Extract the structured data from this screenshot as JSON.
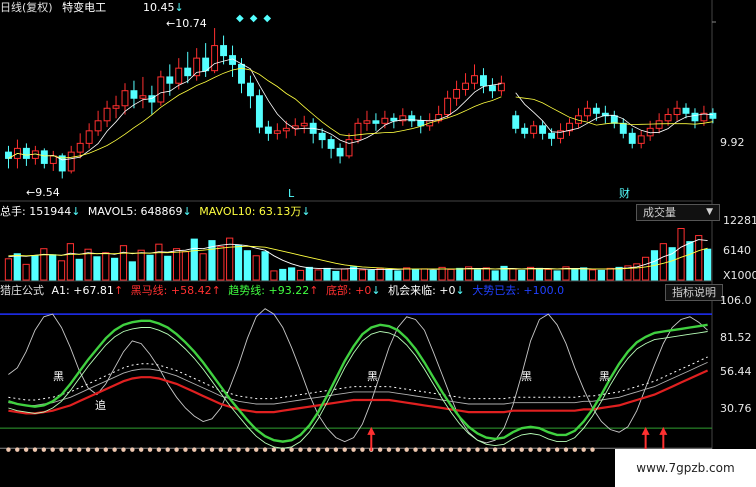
{
  "header": {
    "period_label": "日线(复权)",
    "stock_name": "特变电工"
  },
  "price_panel": {
    "peak_label": "10.45",
    "high_label": "10.74",
    "low_label": "9.54",
    "axis_label": "9.92",
    "marker_l": "L",
    "marker_cai": "财"
  },
  "volume_panel": {
    "legend": [
      {
        "text": "总手: 151944",
        "color": "#ffffff"
      },
      {
        "text": "MAVOL5: 648869",
        "color": "#ffffff"
      },
      {
        "text": "MAVOL10: 63.13万",
        "color": "#ffff40"
      }
    ],
    "selector_label": "成交量",
    "axis_labels": [
      "12281",
      "6140",
      "X1000"
    ],
    "colors": {
      "up": "#ff3030",
      "down": "#54ffff"
    }
  },
  "indicator_panel": {
    "name_label": "猎庄公式",
    "legend": [
      {
        "text": "A1: +67.81",
        "color": "#ffffff"
      },
      {
        "text": "黑马线: +58.42",
        "color": "#ff3030"
      },
      {
        "text": "趋势线: +93.22",
        "color": "#40ff40"
      },
      {
        "text": "底部: +0",
        "color": "#ff3030"
      },
      {
        "text": "机会来临: +0",
        "color": "#ffffff"
      },
      {
        "text": "大势已去: +100.0",
        "color": "#2040ff"
      }
    ],
    "button_label": "指标说明",
    "axis_labels": [
      "106.0",
      "81.52",
      "56.44",
      "30.76"
    ],
    "annotations": [
      "黑",
      "黑",
      "黑",
      "黑",
      "追"
    ],
    "colors": {
      "trend": "#40d040",
      "dark_horse": "#e02020",
      "a1": "#c8c8c8",
      "ref": "#2030ff",
      "base": "#30a030"
    }
  },
  "chart_data": [
    {
      "type": "candlestick",
      "title": "",
      "annotations": [
        "10.45",
        "10.74",
        "9.54"
      ],
      "y_axis_label": "9.92",
      "ylim": [
        9.4,
        10.9
      ],
      "candles": [
        [
          9.75,
          9.7,
          9.8,
          9.62
        ],
        [
          9.7,
          9.78,
          9.85,
          9.62
        ],
        [
          9.78,
          9.7,
          9.82,
          9.64
        ],
        [
          9.7,
          9.76,
          9.8,
          9.65
        ],
        [
          9.76,
          9.66,
          9.78,
          9.62
        ],
        [
          9.66,
          9.72,
          9.76,
          9.6
        ],
        [
          9.72,
          9.6,
          9.74,
          9.54
        ],
        [
          9.6,
          9.75,
          9.8,
          9.58
        ],
        [
          9.75,
          9.82,
          9.9,
          9.7
        ],
        [
          9.82,
          9.92,
          9.98,
          9.78
        ],
        [
          9.92,
          10.0,
          10.08,
          9.88
        ],
        [
          10.0,
          10.1,
          10.16,
          9.95
        ],
        [
          10.1,
          10.12,
          10.2,
          10.02
        ],
        [
          10.12,
          10.24,
          10.3,
          10.05
        ],
        [
          10.24,
          10.18,
          10.32,
          10.1
        ],
        [
          10.18,
          10.2,
          10.35,
          10.1
        ],
        [
          10.2,
          10.15,
          10.28,
          10.05
        ],
        [
          10.15,
          10.35,
          10.4,
          10.12
        ],
        [
          10.35,
          10.3,
          10.45,
          10.2
        ],
        [
          10.3,
          10.42,
          10.5,
          10.25
        ],
        [
          10.42,
          10.36,
          10.55,
          10.3
        ],
        [
          10.36,
          10.5,
          10.58,
          10.32
        ],
        [
          10.5,
          10.4,
          10.62,
          10.35
        ],
        [
          10.4,
          10.6,
          10.74,
          10.38
        ],
        [
          10.6,
          10.52,
          10.68,
          10.45
        ],
        [
          10.52,
          10.45,
          10.6,
          10.35
        ],
        [
          10.45,
          10.3,
          10.5,
          10.22
        ],
        [
          10.3,
          10.2,
          10.36,
          10.1
        ],
        [
          10.2,
          9.95,
          10.25,
          9.9
        ],
        [
          9.95,
          9.9,
          10.0,
          9.84
        ],
        [
          9.9,
          9.92,
          9.98,
          9.85
        ],
        [
          9.92,
          9.94,
          10.0,
          9.86
        ],
        [
          9.94,
          9.96,
          10.02,
          9.88
        ],
        [
          9.96,
          9.98,
          10.04,
          9.9
        ],
        [
          9.98,
          9.9,
          10.02,
          9.82
        ],
        [
          9.9,
          9.85,
          9.94,
          9.78
        ],
        [
          9.85,
          9.78,
          9.88,
          9.7
        ],
        [
          9.78,
          9.72,
          9.82,
          9.66
        ],
        [
          9.72,
          9.85,
          9.9,
          9.7
        ],
        [
          9.85,
          9.98,
          10.02,
          9.82
        ],
        [
          9.98,
          10.0,
          10.08,
          9.92
        ],
        [
          10.0,
          9.98,
          10.06,
          9.92
        ],
        [
          9.98,
          10.02,
          10.08,
          9.94
        ],
        [
          10.02,
          10.0,
          10.06,
          9.94
        ],
        [
          10.0,
          10.04,
          10.1,
          9.96
        ],
        [
          10.04,
          10.0,
          10.08,
          9.95
        ],
        [
          10.0,
          9.96,
          10.04,
          9.9
        ],
        [
          9.96,
          10.0,
          10.06,
          9.92
        ],
        [
          10.0,
          10.05,
          10.12,
          9.98
        ],
        [
          10.05,
          10.18,
          10.24,
          10.02
        ],
        [
          10.18,
          10.25,
          10.32,
          10.12
        ],
        [
          10.25,
          10.3,
          10.38,
          10.2
        ],
        [
          10.3,
          10.36,
          10.45,
          10.25
        ],
        [
          10.36,
          10.28,
          10.42,
          10.22
        ],
        [
          10.28,
          10.24,
          10.34,
          10.18
        ],
        [
          10.24,
          10.3,
          10.36,
          10.2
        ],
        [
          10.04,
          9.94,
          10.08,
          9.9
        ],
        [
          9.94,
          9.9,
          9.98,
          9.86
        ],
        [
          9.9,
          9.96,
          10.0,
          9.86
        ],
        [
          9.96,
          9.9,
          10.0,
          9.85
        ],
        [
          9.9,
          9.86,
          9.94,
          9.8
        ],
        [
          9.86,
          9.92,
          9.98,
          9.82
        ],
        [
          9.92,
          9.98,
          10.02,
          9.88
        ],
        [
          9.98,
          10.04,
          10.1,
          9.94
        ],
        [
          10.04,
          10.1,
          10.16,
          10.0
        ],
        [
          10.1,
          10.06,
          10.14,
          10.0
        ],
        [
          10.06,
          10.04,
          10.12,
          9.98
        ],
        [
          10.04,
          9.98,
          10.08,
          9.94
        ],
        [
          9.98,
          9.9,
          10.02,
          9.86
        ],
        [
          9.9,
          9.82,
          9.94,
          9.78
        ],
        [
          9.82,
          9.88,
          9.92,
          9.78
        ],
        [
          9.88,
          9.94,
          10.0,
          9.84
        ],
        [
          9.94,
          10.0,
          10.06,
          9.9
        ],
        [
          10.0,
          10.05,
          10.1,
          9.96
        ],
        [
          10.05,
          10.1,
          10.16,
          10.0
        ],
        [
          10.1,
          10.06,
          10.14,
          10.02
        ],
        [
          10.06,
          10.0,
          10.1,
          9.94
        ],
        [
          10.0,
          10.06,
          10.12,
          9.96
        ],
        [
          10.06,
          10.02,
          10.1,
          9.98
        ]
      ]
    },
    {
      "type": "bar",
      "title": "",
      "series_labels": [
        "总手",
        "MAVOL5",
        "MAVOL10"
      ],
      "y_axis_labels": [
        "12281",
        "6140",
        "X1000"
      ],
      "ylim": [
        0,
        12281
      ],
      "values": [
        4200,
        5200,
        3100,
        4800,
        6200,
        5000,
        3800,
        7200,
        4100,
        6100,
        4600,
        5400,
        4300,
        6800,
        3600,
        5900,
        4900,
        7100,
        4700,
        6200,
        5600,
        8100,
        5200,
        7800,
        6600,
        8300,
        6900,
        5800,
        4800,
        5600,
        1800,
        2100,
        2400,
        1900,
        2500,
        2000,
        2300,
        1700,
        2200,
        2600,
        2000,
        1900,
        2300,
        2100,
        1800,
        2400,
        2000,
        2200,
        1900,
        2500,
        2100,
        2300,
        2600,
        2000,
        2400,
        1800,
        2700,
        2200,
        1900,
        2500,
        2300,
        2100,
        1800,
        2600,
        2200,
        2400,
        2000,
        1900,
        2300,
        2500,
        2800,
        3200,
        4500,
        5800,
        7200,
        6400,
        10200,
        7600,
        8800,
        6100
      ],
      "up": [
        1,
        0,
        1,
        0,
        1,
        0,
        1,
        1,
        0,
        1,
        0,
        1,
        0,
        1,
        0,
        1,
        0,
        1,
        0,
        1,
        1,
        0,
        1,
        0,
        1,
        1,
        0,
        0,
        1,
        0,
        1,
        0,
        0,
        1,
        0,
        1,
        0,
        0,
        1,
        0,
        1,
        0,
        1,
        0,
        0,
        1,
        0,
        1,
        0,
        1,
        1,
        0,
        1,
        0,
        1,
        0,
        0,
        1,
        0,
        1,
        0,
        1,
        0,
        1,
        0,
        0,
        1,
        0,
        1,
        0,
        1,
        1,
        1,
        0,
        1,
        0,
        1,
        0,
        1,
        0
      ],
      "ma5": [
        4600,
        4800,
        4700,
        4900,
        5100,
        5000,
        4900,
        5300,
        5100,
        5400,
        5200,
        5300,
        5100,
        5500,
        5200,
        5400,
        5300,
        5600,
        5500,
        5800,
        5900,
        6300,
        6200,
        6600,
        6900,
        7100,
        7000,
        6800,
        6300,
        5900,
        4800,
        3900,
        3200,
        2700,
        2400,
        2300,
        2300,
        2200,
        2200,
        2300,
        2200,
        2100,
        2100,
        2100,
        2100,
        2200,
        2200,
        2200,
        2100,
        2200,
        2200,
        2200,
        2300,
        2300,
        2300,
        2200,
        2300,
        2300,
        2200,
        2300,
        2300,
        2300,
        2200,
        2300,
        2300,
        2300,
        2200,
        2200,
        2200,
        2300,
        2400,
        2600,
        3100,
        3700,
        4600,
        5200,
        6500,
        7300,
        8000,
        7800
      ],
      "ma10": [
        4800,
        4900,
        4800,
        4900,
        5000,
        5000,
        4900,
        5100,
        5100,
        5200,
        5200,
        5200,
        5200,
        5300,
        5300,
        5300,
        5300,
        5400,
        5400,
        5500,
        5600,
        5800,
        5900,
        6100,
        6300,
        6500,
        6600,
        6700,
        6600,
        6500,
        6100,
        5700,
        5300,
        4900,
        4500,
        4100,
        3700,
        3300,
        3000,
        2800,
        2600,
        2500,
        2400,
        2300,
        2200,
        2200,
        2200,
        2200,
        2200,
        2200,
        2200,
        2200,
        2200,
        2200,
        2200,
        2200,
        2200,
        2200,
        2200,
        2200,
        2200,
        2200,
        2200,
        2200,
        2200,
        2200,
        2200,
        2200,
        2200,
        2200,
        2300,
        2400,
        2600,
        2900,
        3300,
        3800,
        4500,
        5100,
        5800,
        6300
      ]
    },
    {
      "type": "line",
      "title": "",
      "series_labels": [
        "A1",
        "黑马线",
        "趋势线",
        "大势已去"
      ],
      "y_axis_labels": [
        "106.0",
        "81.52",
        "56.44",
        "30.76"
      ],
      "ylim": [
        -5,
        112
      ],
      "reference_lines": [
        100,
        0
      ],
      "trend": [
        35,
        33,
        32,
        31,
        32,
        35,
        40,
        48,
        57,
        66,
        74,
        82,
        88,
        92,
        94,
        95,
        95,
        93,
        90,
        85,
        79,
        72,
        64,
        55,
        46,
        37,
        29,
        21,
        14,
        9,
        6,
        5,
        6,
        10,
        17,
        27,
        39,
        52,
        65,
        76,
        85,
        90,
        92,
        91,
        88,
        82,
        74,
        64,
        53,
        42,
        32,
        23,
        16,
        11,
        8,
        7,
        8,
        12,
        15,
        16,
        15,
        12,
        10,
        10,
        13,
        20,
        29,
        40,
        52,
        63,
        72,
        79,
        83,
        86,
        87,
        88,
        89,
        90,
        91,
        92
      ],
      "a1": [
        55,
        60,
        72,
        88,
        98,
        100,
        90,
        75,
        58,
        45,
        40,
        48,
        60,
        72,
        80,
        78,
        70,
        60,
        48,
        38,
        30,
        24,
        20,
        22,
        30,
        45,
        62,
        82,
        98,
        104,
        100,
        90,
        75,
        58,
        40,
        25,
        15,
        8,
        5,
        8,
        18,
        35,
        55,
        75,
        90,
        98,
        96,
        88,
        72,
        55,
        38,
        22,
        12,
        6,
        4,
        6,
        15,
        32,
        55,
        80,
        96,
        100,
        92,
        78,
        60,
        44,
        30,
        20,
        14,
        12,
        16,
        28,
        45,
        62,
        78,
        90,
        96,
        98,
        94,
        88
      ],
      "dark_horse": [
        28,
        27,
        26,
        26,
        27,
        28,
        30,
        32,
        35,
        38,
        41,
        44,
        47,
        50,
        52,
        53,
        53,
        52,
        50,
        48,
        45,
        42,
        39,
        36,
        33,
        31,
        29,
        28,
        27,
        27,
        27,
        28,
        29,
        30,
        31,
        32,
        33,
        34,
        35,
        36,
        36,
        36,
        36,
        36,
        35,
        34,
        33,
        32,
        31,
        30,
        29,
        28,
        27,
        27,
        27,
        27,
        27,
        28,
        28,
        28,
        28,
        28,
        28,
        28,
        28,
        29,
        29,
        30,
        31,
        32,
        34,
        36,
        38,
        40,
        43,
        46,
        49,
        52,
        55,
        58
      ],
      "bottom_marker_x": [
        41,
        72,
        74
      ]
    }
  ]
}
